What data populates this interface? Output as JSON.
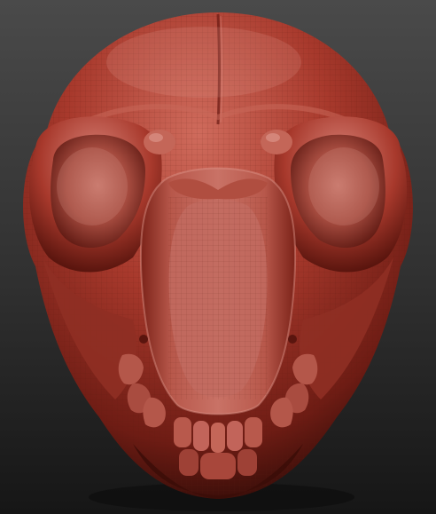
{
  "viewport": {
    "background_top": "#4a4a4a",
    "background_bottom": "#161616"
  },
  "sculpt": {
    "subject": "skull-sculpt",
    "material_color": "#a8392c",
    "highlight_color": "#d9857a",
    "shadow_color": "#4a120c",
    "wire_color": "#5a1a12"
  }
}
